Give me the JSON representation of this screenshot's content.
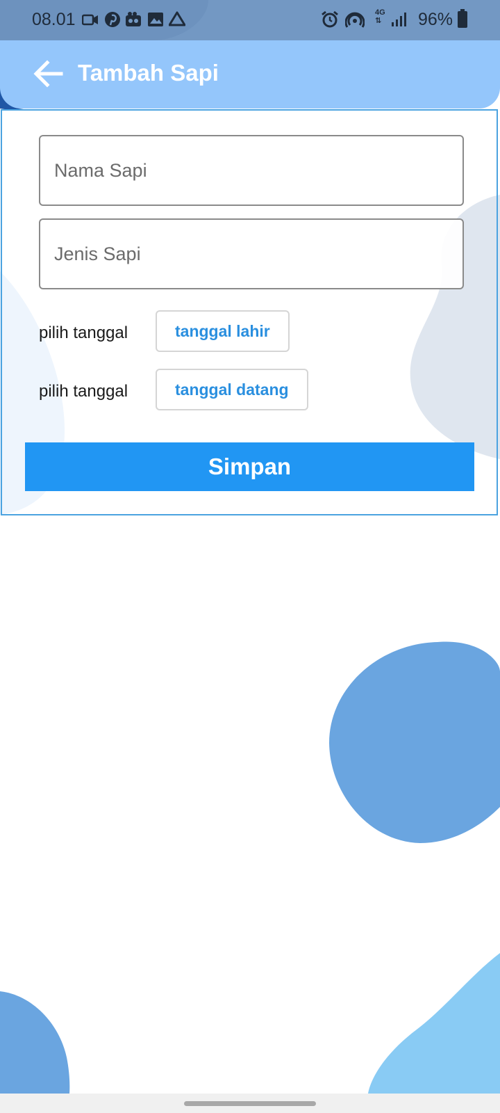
{
  "status_bar": {
    "time": "08.01",
    "battery": "96%",
    "network": "4G",
    "left_icons": [
      "video-camera-icon",
      "pinterest-icon",
      "screen-recorder-icon",
      "gallery-icon",
      "drive-icon"
    ],
    "right_icons": [
      "alarm-icon",
      "hotspot-icon",
      "signal-icon",
      "battery-icon"
    ]
  },
  "app_bar": {
    "title": "Tambah Sapi",
    "back_icon": "arrow-left-icon"
  },
  "form": {
    "nama_placeholder": "Nama Sapi",
    "jenis_placeholder": "Jenis Sapi",
    "rows": [
      {
        "label": "pilih tanggal",
        "button": "tanggal lahir"
      },
      {
        "label": "pilih tanggal",
        "button": "tanggal datang"
      }
    ],
    "save_label": "Simpan"
  },
  "colors": {
    "status_bar": "#7398c3",
    "app_bar": "#94c6fb",
    "accent": "#2196f3",
    "card_border": "#4ba3e0",
    "blob_mid": "#6aa5e0",
    "blob_light": "#89cbf4"
  }
}
